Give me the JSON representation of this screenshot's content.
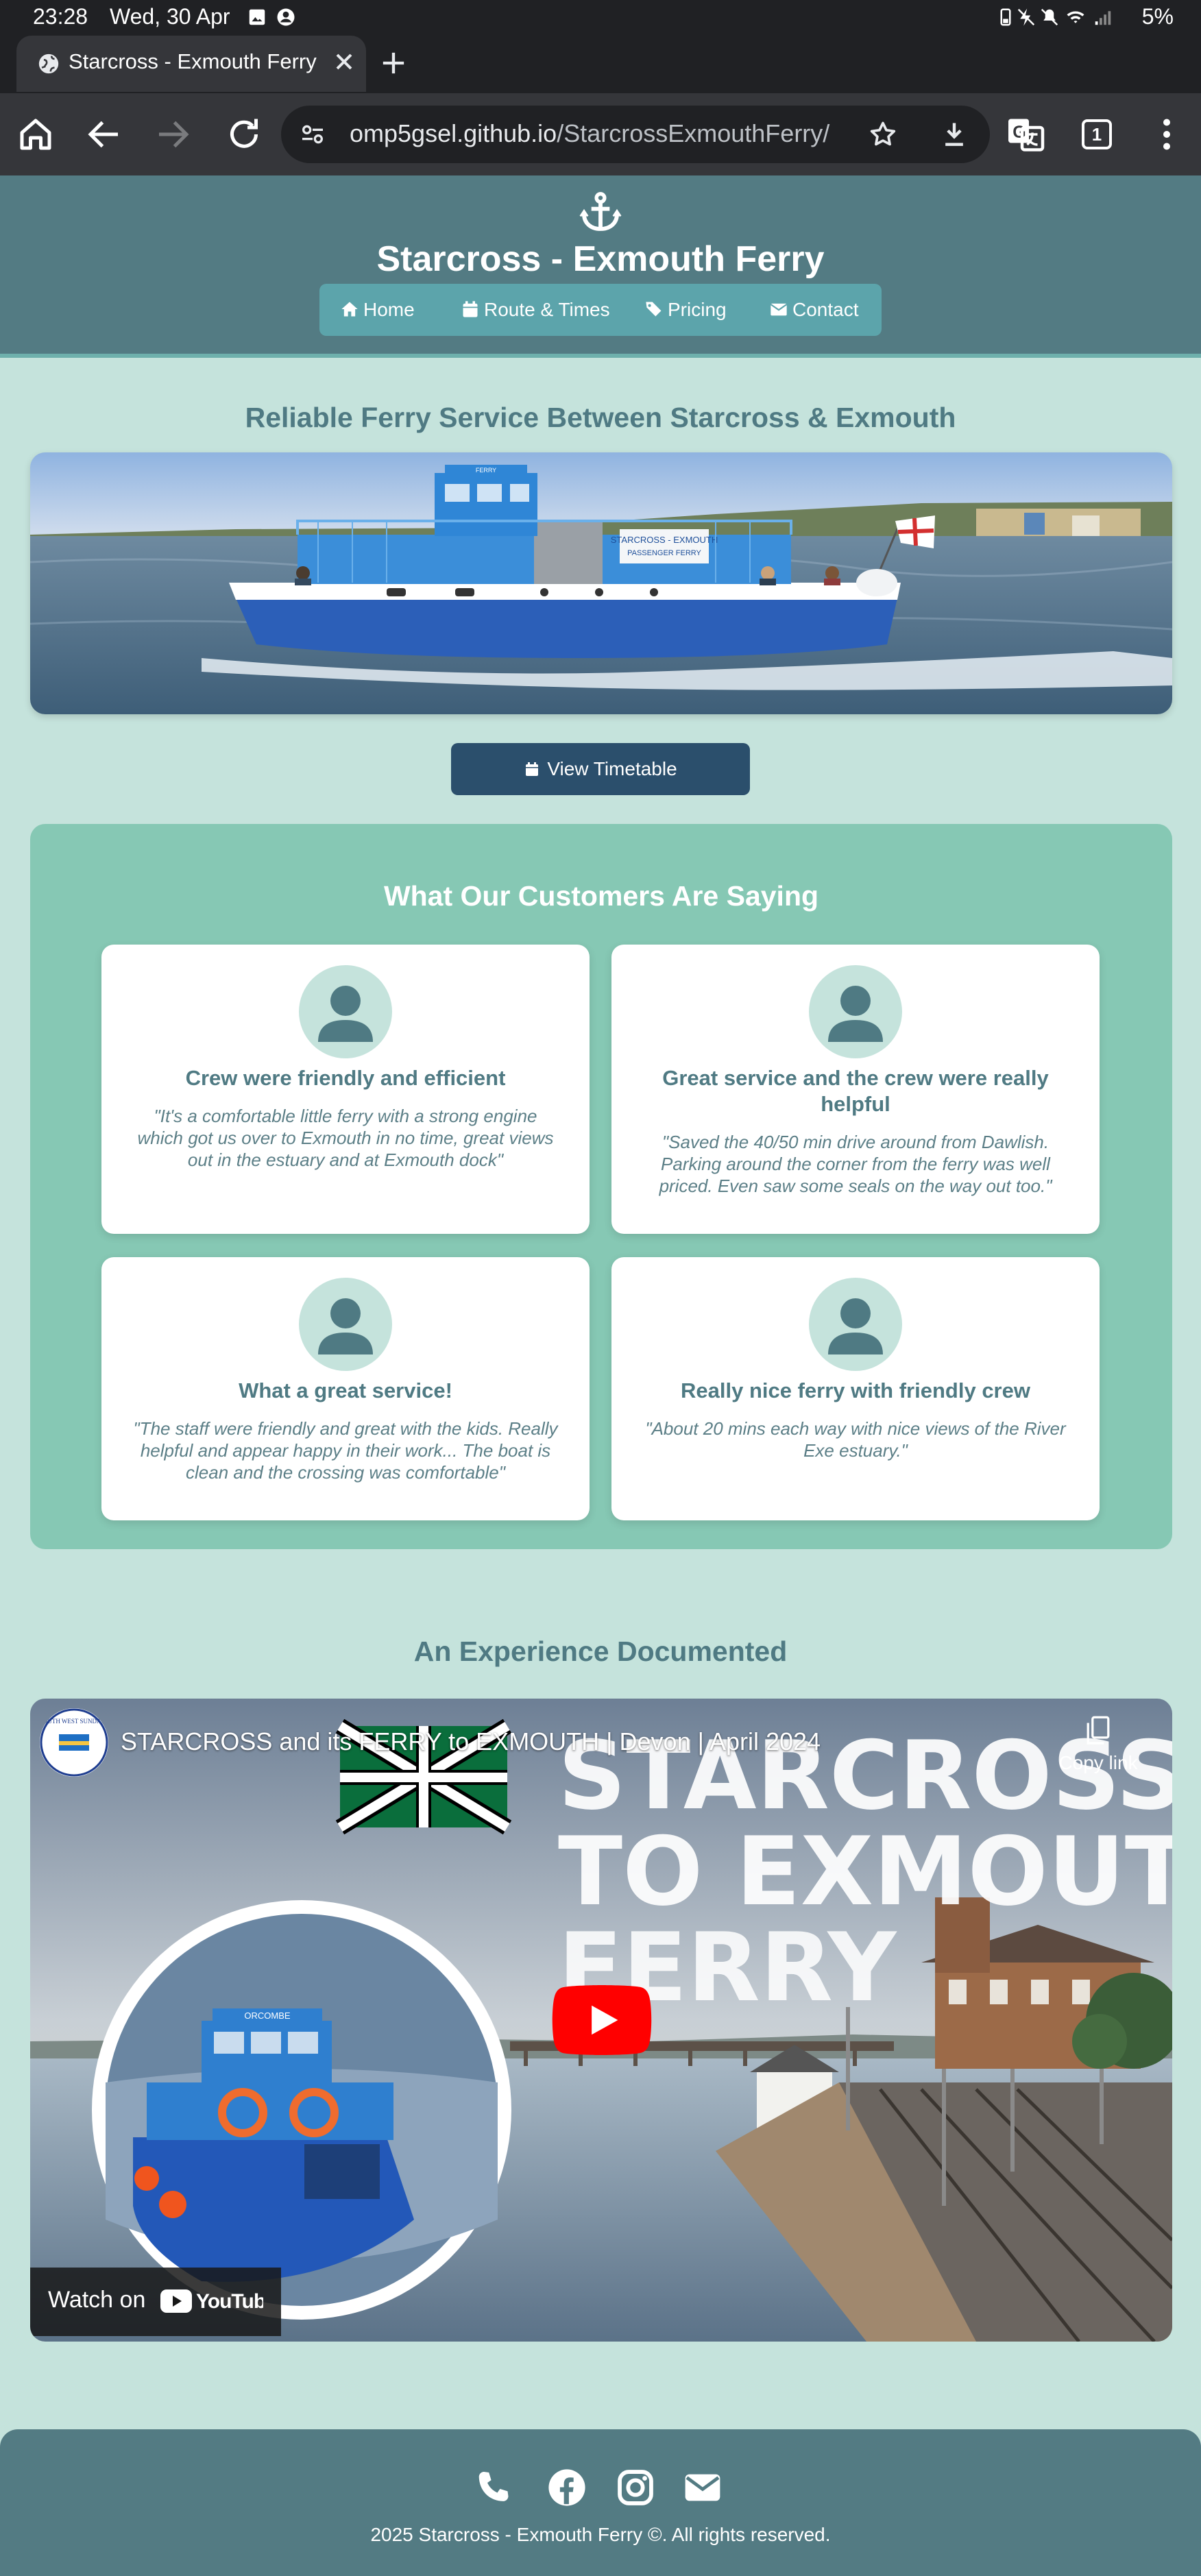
{
  "status_bar": {
    "time": "23:28",
    "date": "Wed, 30 Apr",
    "battery": "5%"
  },
  "browser": {
    "tab_title": "Starcross - Exmouth Ferry",
    "url_host": "omp5gsel.github.io",
    "url_path": "/StarcrossExmouthFerry/",
    "tab_count": "1"
  },
  "site": {
    "title": "Starcross - Exmouth Ferry",
    "nav": [
      {
        "label": "Home",
        "icon": "home-icon"
      },
      {
        "label": "Route & Times",
        "icon": "calendar-icon"
      },
      {
        "label": "Pricing",
        "icon": "tags-icon"
      },
      {
        "label": "Contact",
        "icon": "envelope-icon"
      }
    ],
    "hero_title": "Reliable Ferry Service Between Starcross & Exmouth",
    "hero_image_lettering": [
      "STARCROSS - EXMOUTH",
      "PASSENGER FERRY",
      "FERRY"
    ],
    "timetable_button": "View Timetable",
    "testimonials_title": "What Our Customers Are Saying",
    "testimonials": [
      {
        "title": "Crew were friendly and efficient",
        "quote": "\"It's a comfortable little ferry with a strong engine which got us over to Exmouth in no time, great views out in the estuary and at Exmouth dock\""
      },
      {
        "title": "Great service and the crew were really helpful",
        "quote": "\"Saved the 40/50 min drive around from Dawlish. Parking around the corner from the ferry was well priced. Even saw some seals on the way out too.\""
      },
      {
        "title": "What a great service!",
        "quote": "\"The staff were friendly and great with the kids. Really helpful and appear happy in their work... The boat is clean and the crossing was comfortable\""
      },
      {
        "title": "Really nice ferry with friendly crew",
        "quote": "\"About 20 mins each way with nice views of the River Exe estuary.\""
      }
    ],
    "video_title": "An Experience Documented",
    "video": {
      "title": "STARCROSS and its FERRY to EXMOUTH | Devon | April 2024",
      "copy_link": "Copy link",
      "watch_on": "Watch on",
      "youtube": "YouTube",
      "thumbnail_lettering": [
        "STARCROSS",
        "TO EXMOUTH",
        "FERRY",
        "ORCOMBE",
        "SOUTH WEST SUNDAYS"
      ]
    },
    "footer_icons": [
      "phone-icon",
      "facebook-icon",
      "instagram-icon",
      "envelope-icon"
    ],
    "copyright": "2025 Starcross - Exmouth Ferry ©. All rights reserved."
  },
  "colors": {
    "page_bg": "#c5e3dc",
    "header_bg": "#537b83",
    "nav_bg": "#5ca4ab",
    "heading": "#4f7a83",
    "button": "#2b4f6c",
    "testimonials_bg": "#86c8b4",
    "youtube_red": "#ff0000"
  }
}
